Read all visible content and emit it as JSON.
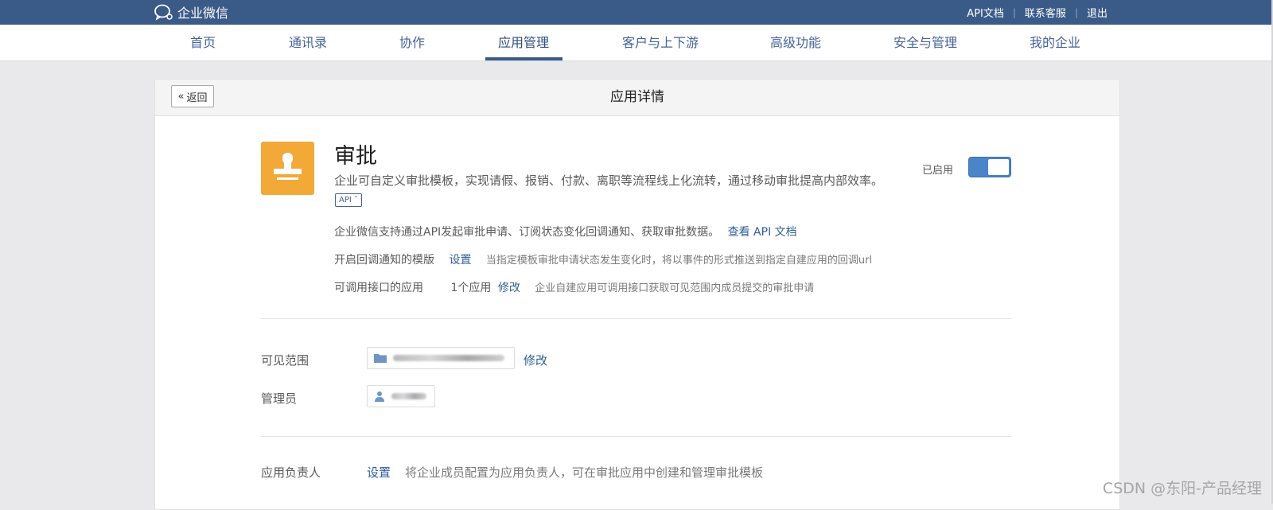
{
  "topbar": {
    "logo_text": "企业微信",
    "links": [
      "API文档",
      "联系客服",
      "退出"
    ]
  },
  "nav": {
    "items": [
      "首页",
      "通讯录",
      "协作",
      "应用管理",
      "客户与上下游",
      "高级功能",
      "安全与管理",
      "我的企业"
    ],
    "active": "应用管理"
  },
  "page": {
    "back_label": "返回",
    "title": "应用详情"
  },
  "app": {
    "name": "审批",
    "description": "企业可自定义审批模板，实现请假、报销、付款、离职等流程线上化流转，通过移动审批提高内部效率。",
    "api_tag": "API",
    "status_label": "已启用",
    "enabled": true,
    "icon": "stamp-icon",
    "icon_color": "#f2a937"
  },
  "api_info": {
    "line1_text": "企业微信支持通过API发起审批申请、订阅状态变化回调通知、获取审批数据。",
    "line1_link": "查看 API 文档",
    "line2_label": "开启回调通知的模版",
    "line2_link": "设置",
    "line2_note": "当指定模板审批申请状态发生变化时，将以事件的形式推送到指定自建应用的回调url",
    "line3_label": "可调用接口的应用",
    "line3_count": "1个应用",
    "line3_link": "修改",
    "line3_note": "企业自建应用可调用接口获取可见范围内成员提交的审批申请"
  },
  "visibility": {
    "label": "可见范围",
    "edit_link": "修改"
  },
  "admin": {
    "label": "管理员"
  },
  "owner": {
    "label": "应用负责人",
    "link": "设置",
    "note": "将企业成员配置为应用负责人，可在审批应用中创建和管理审批模板"
  },
  "watermark": "CSDN @东阳-产品经理",
  "colors": {
    "topbar": "#3a5a88",
    "link": "#2f5f9a",
    "toggle": "#4a84c9"
  }
}
